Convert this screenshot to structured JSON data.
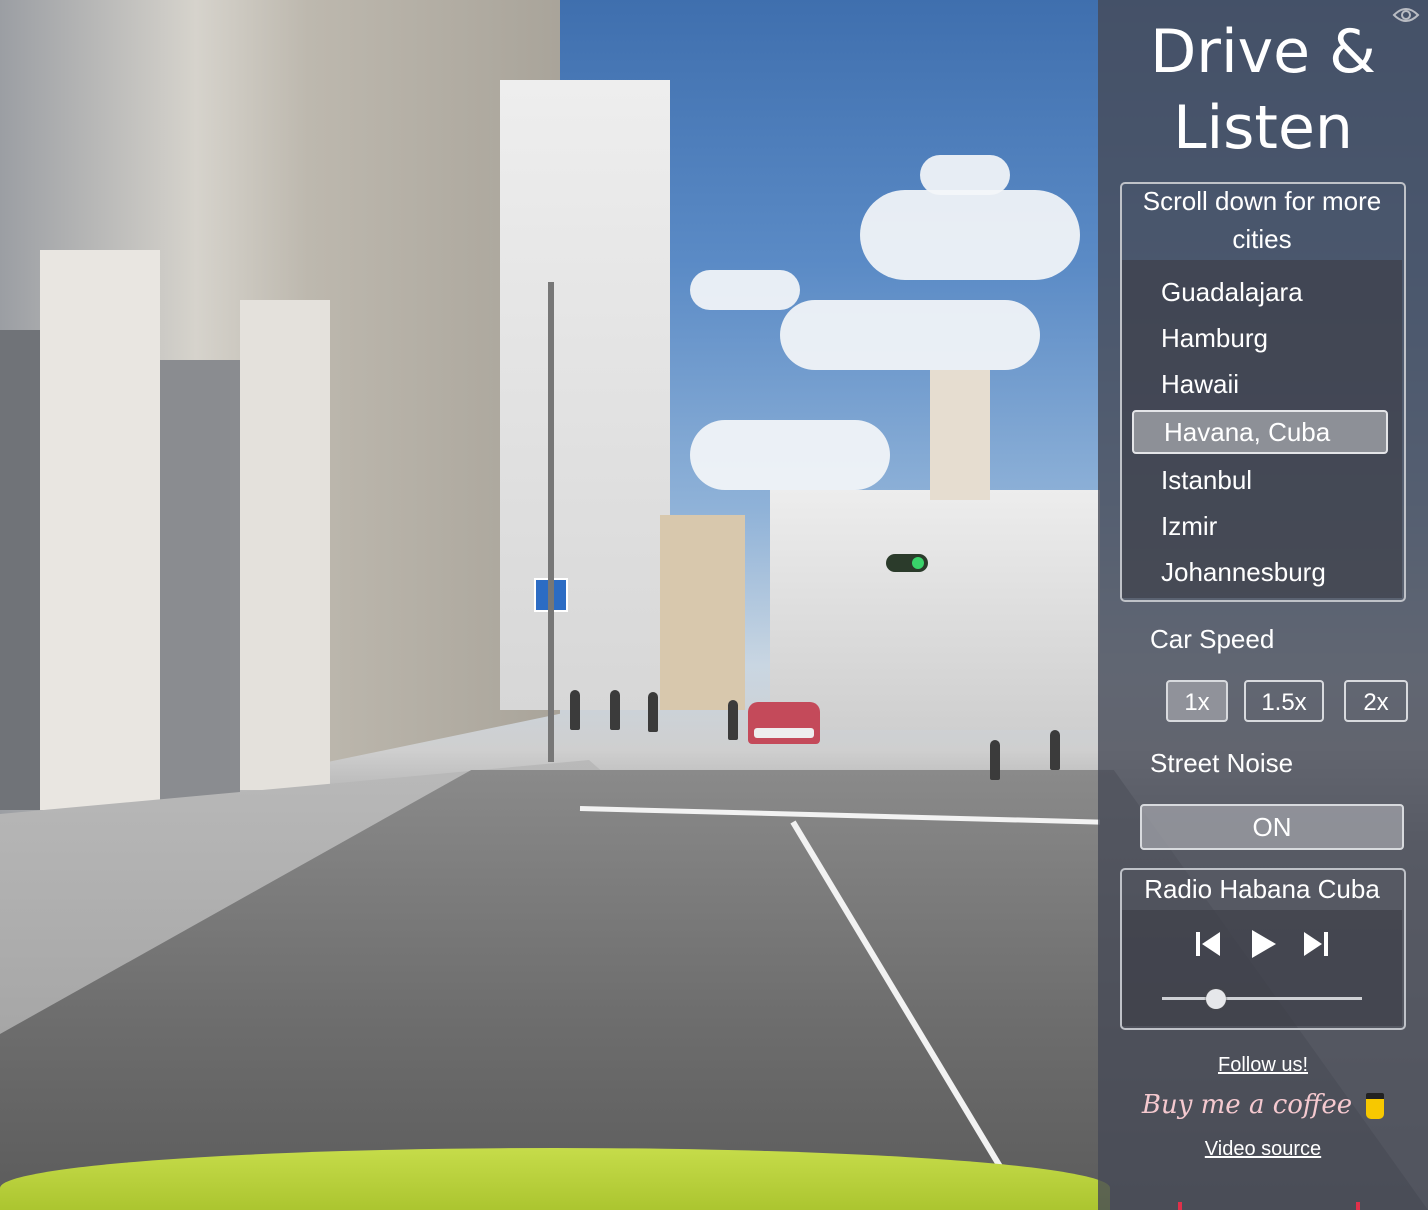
{
  "app": {
    "title_line1": "Drive &",
    "title_line2": "Listen"
  },
  "icons": {
    "visibility": "eye-icon",
    "previous": "skip-previous-icon",
    "play": "play-icon",
    "next": "skip-next-icon",
    "coffee_cup": "coffee-cup-icon"
  },
  "cities": {
    "scroll_hint": "Scroll down for more cities",
    "items": [
      "Guadalajara",
      "Hamburg",
      "Hawaii",
      "Havana, Cuba",
      "Istanbul",
      "Izmir",
      "Johannesburg"
    ],
    "selected": "Havana, Cuba"
  },
  "car_speed": {
    "label": "Car Speed",
    "options": [
      "1x",
      "1.5x",
      "2x"
    ],
    "selected": "1x"
  },
  "street_noise": {
    "label": "Street Noise",
    "state": "ON"
  },
  "radio": {
    "station": "Radio Habana Cuba",
    "volume": 0.27
  },
  "links": {
    "follow": "Follow us!",
    "coffee": "Buy me a coffee",
    "video_source": "Video source"
  },
  "colors": {
    "panel_bg": "#464a56",
    "coffee_text": "#f5c9cf",
    "accent_red": "#e0304a"
  }
}
